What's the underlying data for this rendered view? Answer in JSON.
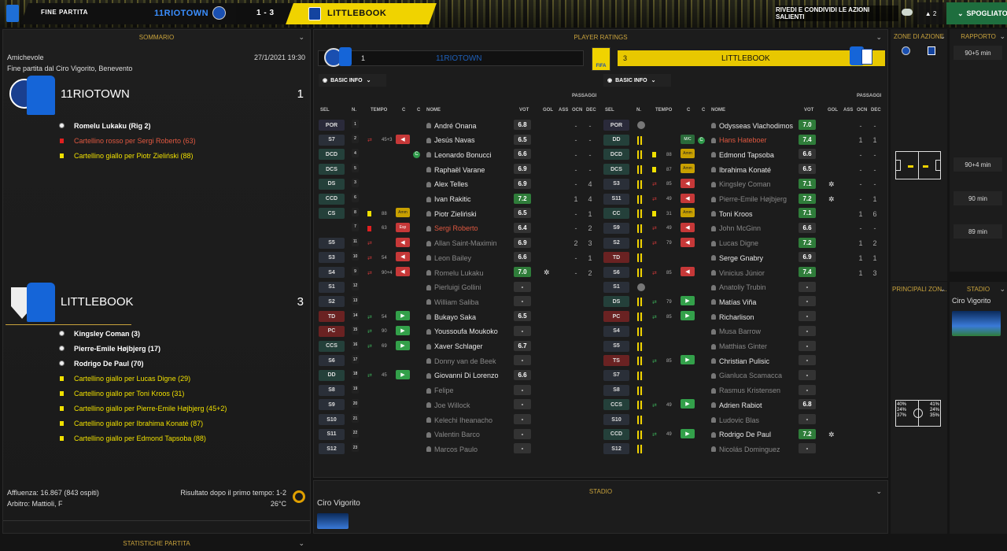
{
  "topbar": {
    "menu": "FINE PARTITA",
    "home_team": "11RIOTOWN",
    "score": "1 - 3",
    "away_team": "LITTLEBOOK",
    "share": "RIVEDI E CONDIVIDI LE AZIONI SALIENTI",
    "count": "2",
    "locker": "SPOGLIATOIO"
  },
  "summary": {
    "title": "SOMMARIO",
    "competition": "Amichevole",
    "datetime": "27/1/2021 19:30",
    "venue_line": "Fine partita dal Ciro Vigorito, Benevento",
    "home": {
      "name": "11RIOTOWN",
      "goals": "1",
      "events": [
        {
          "type": "goal",
          "text": "Romelu Lukaku (Rig 2)"
        },
        {
          "type": "red",
          "text": "Cartellino rosso per Sergi Roberto (63)"
        },
        {
          "type": "yellow",
          "text": "Cartellino giallo per Piotr Zieliński (88)"
        }
      ]
    },
    "away": {
      "name": "LITTLEBOOK",
      "goals": "3",
      "events": [
        {
          "type": "goal",
          "text": "Kingsley Coman (3)"
        },
        {
          "type": "goal",
          "text": "Pierre-Emile Højbjerg (17)"
        },
        {
          "type": "goal",
          "text": "Rodrigo De Paul (70)"
        },
        {
          "type": "yellow",
          "text": "Cartellino giallo per Lucas Digne (29)"
        },
        {
          "type": "yellow",
          "text": "Cartellino giallo per Toni Kroos (31)"
        },
        {
          "type": "yellow",
          "text": "Cartellino giallo per Pierre-Emile Højbjerg (45+2)"
        },
        {
          "type": "yellow",
          "text": "Cartellino giallo per Ibrahima Konaté (87)"
        },
        {
          "type": "yellow",
          "text": "Cartellino giallo per Edmond Tapsoba (88)"
        }
      ]
    },
    "attendance": "Affluenza: 16.867 (843 ospiti)",
    "halftime": "Risultato dopo il primo tempo: 1-2",
    "referee": "Arbitro: Mattioli, F",
    "temperature": "26°C",
    "stats_title": "STATISTICHE PARTITA"
  },
  "ratings": {
    "title": "PLAYER RATINGS",
    "home_score": "1",
    "home_name": "11RIOTOWN",
    "away_score": "3",
    "away_name": "LITTLEBOOK",
    "basic_info": "BASIC INFO",
    "passaggi": "PASSAGGI",
    "cols": {
      "sel": "SEL",
      "n": "N.",
      "tempo": "TEMPO",
      "c": "C",
      "nome": "NOME",
      "vot": "VOT",
      "gol": "GOL",
      "ass": "ASS",
      "ocn": "OCN",
      "dec": "DEC"
    },
    "home_players": [
      {
        "pos": "POR",
        "n": "1",
        "name": "André Onana",
        "vot": "6.8",
        "ocn": "-",
        "dec": "-",
        "gol": "",
        "tempo": "",
        "sub": "",
        "style": "",
        "rg": false
      },
      {
        "pos": "S7",
        "n": "2",
        "name": "Jesús Navas",
        "vot": "6.5",
        "ocn": "-",
        "dec": "-",
        "tempo": "45+3",
        "sub": "out",
        "style": "",
        "rg": false
      },
      {
        "pos": "DCD",
        "n": "4",
        "name": "Leonardo Bonucci",
        "vot": "6.6",
        "ocn": "-",
        "dec": "-",
        "tempo": "",
        "sub": "",
        "c": "C",
        "style": "",
        "rg": false
      },
      {
        "pos": "DCS",
        "n": "5",
        "name": "Raphaël Varane",
        "vot": "6.9",
        "ocn": "-",
        "dec": "-",
        "tempo": "",
        "sub": "",
        "style": "",
        "rg": false
      },
      {
        "pos": "DS",
        "n": "3",
        "name": "Alex Telles",
        "vot": "6.9",
        "ocn": "-",
        "dec": "4",
        "tempo": "",
        "sub": "",
        "style": "",
        "rg": false
      },
      {
        "pos": "CCD",
        "n": "6",
        "name": "Ivan Rakitic",
        "vot": "7.2",
        "ocn": "1",
        "dec": "4",
        "tempo": "",
        "sub": "",
        "style": "",
        "rg": true
      },
      {
        "pos": "CS",
        "n": "8",
        "name": "Piotr Zieliński",
        "vot": "6.5",
        "ocn": "-",
        "dec": "1",
        "tempo": "88",
        "sub": "amm",
        "card": "y",
        "style": "",
        "rg": false
      },
      {
        "pos": "",
        "n": "7",
        "name": "Sergi Roberto",
        "vot": "6.4",
        "ocn": "-",
        "dec": "2",
        "tempo": "63",
        "sub": "esp",
        "card": "r",
        "style": "red",
        "rg": false
      },
      {
        "pos": "S5",
        "n": "11",
        "name": "Allan Saint-Maximin",
        "vot": "6.9",
        "ocn": "2",
        "dec": "3",
        "tempo": "",
        "sub": "out",
        "style": "dim",
        "rg": false
      },
      {
        "pos": "S3",
        "n": "10",
        "name": "Leon Bailey",
        "vot": "6.6",
        "ocn": "-",
        "dec": "1",
        "tempo": "54",
        "sub": "out",
        "style": "dim",
        "rg": false
      },
      {
        "pos": "S4",
        "n": "9",
        "name": "Romelu Lukaku",
        "vot": "7.0",
        "ocn": "-",
        "dec": "2",
        "tempo": "90+4",
        "sub": "out",
        "gol": "b",
        "style": "dim",
        "rg": true
      },
      {
        "pos": "S1",
        "n": "12",
        "name": "Pierluigi Gollini",
        "vot": "-",
        "ocn": "",
        "dec": "",
        "style": "dim",
        "rg": false
      },
      {
        "pos": "S2",
        "n": "13",
        "name": "William Saliba",
        "vot": "-",
        "ocn": "",
        "dec": "",
        "style": "dim",
        "rg": false
      },
      {
        "pos": "TD",
        "n": "14",
        "name": "Bukayo Saka",
        "vot": "6.5",
        "ocn": "",
        "dec": "",
        "tempo": "54",
        "sub": "in",
        "style": "",
        "rg": false
      },
      {
        "pos": "PC",
        "n": "15",
        "name": "Youssoufa Moukoko",
        "vot": "-",
        "ocn": "",
        "dec": "",
        "tempo": "90",
        "sub": "in",
        "style": "",
        "rg": false
      },
      {
        "pos": "CCS",
        "n": "16",
        "name": "Xaver Schlager",
        "vot": "6.7",
        "ocn": "",
        "dec": "",
        "tempo": "69",
        "sub": "in",
        "style": "",
        "rg": false
      },
      {
        "pos": "S6",
        "n": "17",
        "name": "Donny van de Beek",
        "vot": "-",
        "ocn": "",
        "dec": "",
        "style": "dim",
        "rg": false
      },
      {
        "pos": "DD",
        "n": "18",
        "name": "Giovanni Di Lorenzo",
        "vot": "6.6",
        "ocn": "",
        "dec": "",
        "tempo": "45",
        "sub": "in",
        "style": "",
        "rg": false
      },
      {
        "pos": "S8",
        "n": "19",
        "name": "Felipe",
        "vot": "-",
        "ocn": "",
        "dec": "",
        "style": "dim",
        "rg": false
      },
      {
        "pos": "S9",
        "n": "20",
        "name": "Joe Willock",
        "vot": "-",
        "ocn": "",
        "dec": "",
        "style": "dim",
        "rg": false
      },
      {
        "pos": "S10",
        "n": "21",
        "name": "Kelechi Iheanacho",
        "vot": "-",
        "ocn": "",
        "dec": "",
        "style": "dim",
        "rg": false
      },
      {
        "pos": "S11",
        "n": "22",
        "name": "Valentin Barco",
        "vot": "-",
        "ocn": "",
        "dec": "",
        "style": "dim",
        "rg": false
      },
      {
        "pos": "S12",
        "n": "23",
        "name": "Marcos Paulo",
        "vot": "-",
        "ocn": "",
        "dec": "",
        "style": "dim",
        "rg": false
      }
    ],
    "away_players": [
      {
        "pos": "POR",
        "name": "Odysseas Vlachodimos",
        "vot": "7.0",
        "ocn": "-",
        "dec": "-",
        "gk": true,
        "style": "",
        "rg": true
      },
      {
        "pos": "DD",
        "name": "Hans Hateboer",
        "vot": "7.4",
        "ocn": "1",
        "dec": "1",
        "sub": "mic",
        "style": "red",
        "rg": true
      },
      {
        "pos": "DCD",
        "name": "Edmond Tapsoba",
        "vot": "6.6",
        "ocn": "-",
        "dec": "-",
        "tempo": "88",
        "sub": "amm",
        "card": "y",
        "style": "",
        "rg": false
      },
      {
        "pos": "DCS",
        "name": "Ibrahima Konaté",
        "vot": "6.5",
        "ocn": "-",
        "dec": "-",
        "tempo": "87",
        "sub": "amm",
        "card": "y",
        "style": "",
        "rg": false
      },
      {
        "pos": "S3",
        "name": "Kingsley Coman",
        "vot": "7.1",
        "ocn": "-",
        "dec": "-",
        "tempo": "85",
        "sub": "out",
        "gol": "b",
        "style": "dim",
        "rg": true
      },
      {
        "pos": "S11",
        "name": "Pierre-Emile Højbjerg",
        "vot": "7.2",
        "ocn": "-",
        "dec": "1",
        "tempo": "49",
        "sub": "out",
        "gol": "b",
        "style": "dim",
        "rg": true
      },
      {
        "pos": "CC",
        "name": "Toni Kroos",
        "vot": "7.1",
        "ocn": "1",
        "dec": "6",
        "tempo": "31",
        "sub": "amm",
        "card": "y",
        "style": "",
        "rg": true
      },
      {
        "pos": "S9",
        "name": "John McGinn",
        "vot": "6.6",
        "ocn": "-",
        "dec": "-",
        "tempo": "49",
        "sub": "out",
        "style": "dim",
        "rg": false
      },
      {
        "pos": "S2",
        "name": "Lucas Digne",
        "vot": "7.2",
        "ocn": "1",
        "dec": "2",
        "tempo": "79",
        "sub": "out",
        "style": "dim",
        "rg": true
      },
      {
        "pos": "TD",
        "name": "Serge Gnabry",
        "vot": "6.9",
        "ocn": "1",
        "dec": "1",
        "style": "",
        "rg": false
      },
      {
        "pos": "S6",
        "name": "Vinicius Júnior",
        "vot": "7.4",
        "ocn": "1",
        "dec": "3",
        "tempo": "85",
        "sub": "out",
        "style": "dim",
        "rg": true
      },
      {
        "pos": "S1",
        "name": "Anatoliy Trubin",
        "vot": "-",
        "ocn": "",
        "dec": "",
        "gk": true,
        "style": "dim",
        "rg": false
      },
      {
        "pos": "DS",
        "name": "Matías Viña",
        "vot": "-",
        "ocn": "",
        "dec": "",
        "tempo": "79",
        "sub": "in",
        "style": "",
        "rg": false
      },
      {
        "pos": "PC",
        "name": "Richarlison",
        "vot": "-",
        "ocn": "",
        "dec": "",
        "tempo": "85",
        "sub": "in",
        "style": "",
        "rg": false
      },
      {
        "pos": "S4",
        "name": "Musa Barrow",
        "vot": "-",
        "ocn": "",
        "dec": "",
        "style": "dim",
        "rg": false
      },
      {
        "pos": "S5",
        "name": "Matthias Ginter",
        "vot": "-",
        "ocn": "",
        "dec": "",
        "style": "dim",
        "rg": false
      },
      {
        "pos": "TS",
        "name": "Christian Pulisic",
        "vot": "-",
        "ocn": "",
        "dec": "",
        "tempo": "85",
        "sub": "in",
        "style": "",
        "rg": false
      },
      {
        "pos": "S7",
        "name": "Gianluca Scamacca",
        "vot": "-",
        "ocn": "",
        "dec": "",
        "style": "dim",
        "rg": false
      },
      {
        "pos": "S8",
        "name": "Rasmus Kristensen",
        "vot": "-",
        "ocn": "",
        "dec": "",
        "style": "dim",
        "rg": false
      },
      {
        "pos": "CCS",
        "name": "Adrien Rabiot",
        "vot": "6.8",
        "ocn": "",
        "dec": "",
        "tempo": "49",
        "sub": "in",
        "style": "",
        "rg": false
      },
      {
        "pos": "S10",
        "name": "Ludovic Blas",
        "vot": "-",
        "ocn": "",
        "dec": "",
        "style": "dim",
        "rg": false
      },
      {
        "pos": "CCD",
        "name": "Rodrigo De Paul",
        "vot": "7.2",
        "ocn": "",
        "dec": "",
        "tempo": "49",
        "sub": "in",
        "gol": "b",
        "style": "",
        "rg": true
      },
      {
        "pos": "S12",
        "name": "Nicolás Dominguez",
        "vot": "-",
        "ocn": "",
        "dec": "",
        "style": "dim",
        "rg": false
      }
    ]
  },
  "stadium": {
    "title": "STADIO",
    "name": "Ciro Vigorito"
  },
  "zone": {
    "title": "ZONE DI AZIONE",
    "main_title": "PRINCIPALI ZON...",
    "pct": [
      "40%",
      "24%",
      "37%",
      "41%",
      "24%",
      "35%"
    ]
  },
  "report": {
    "title": "RAPPORTO",
    "times": [
      "90+5 min",
      "90+4 min",
      "90 min",
      "89 min"
    ]
  },
  "side_stadium": {
    "title": "STADIO",
    "name": "Ciro Vigorito"
  },
  "colors": {
    "gold": "#c8a23c",
    "yellow": "#f0d300",
    "green": "#2f7d3a"
  }
}
